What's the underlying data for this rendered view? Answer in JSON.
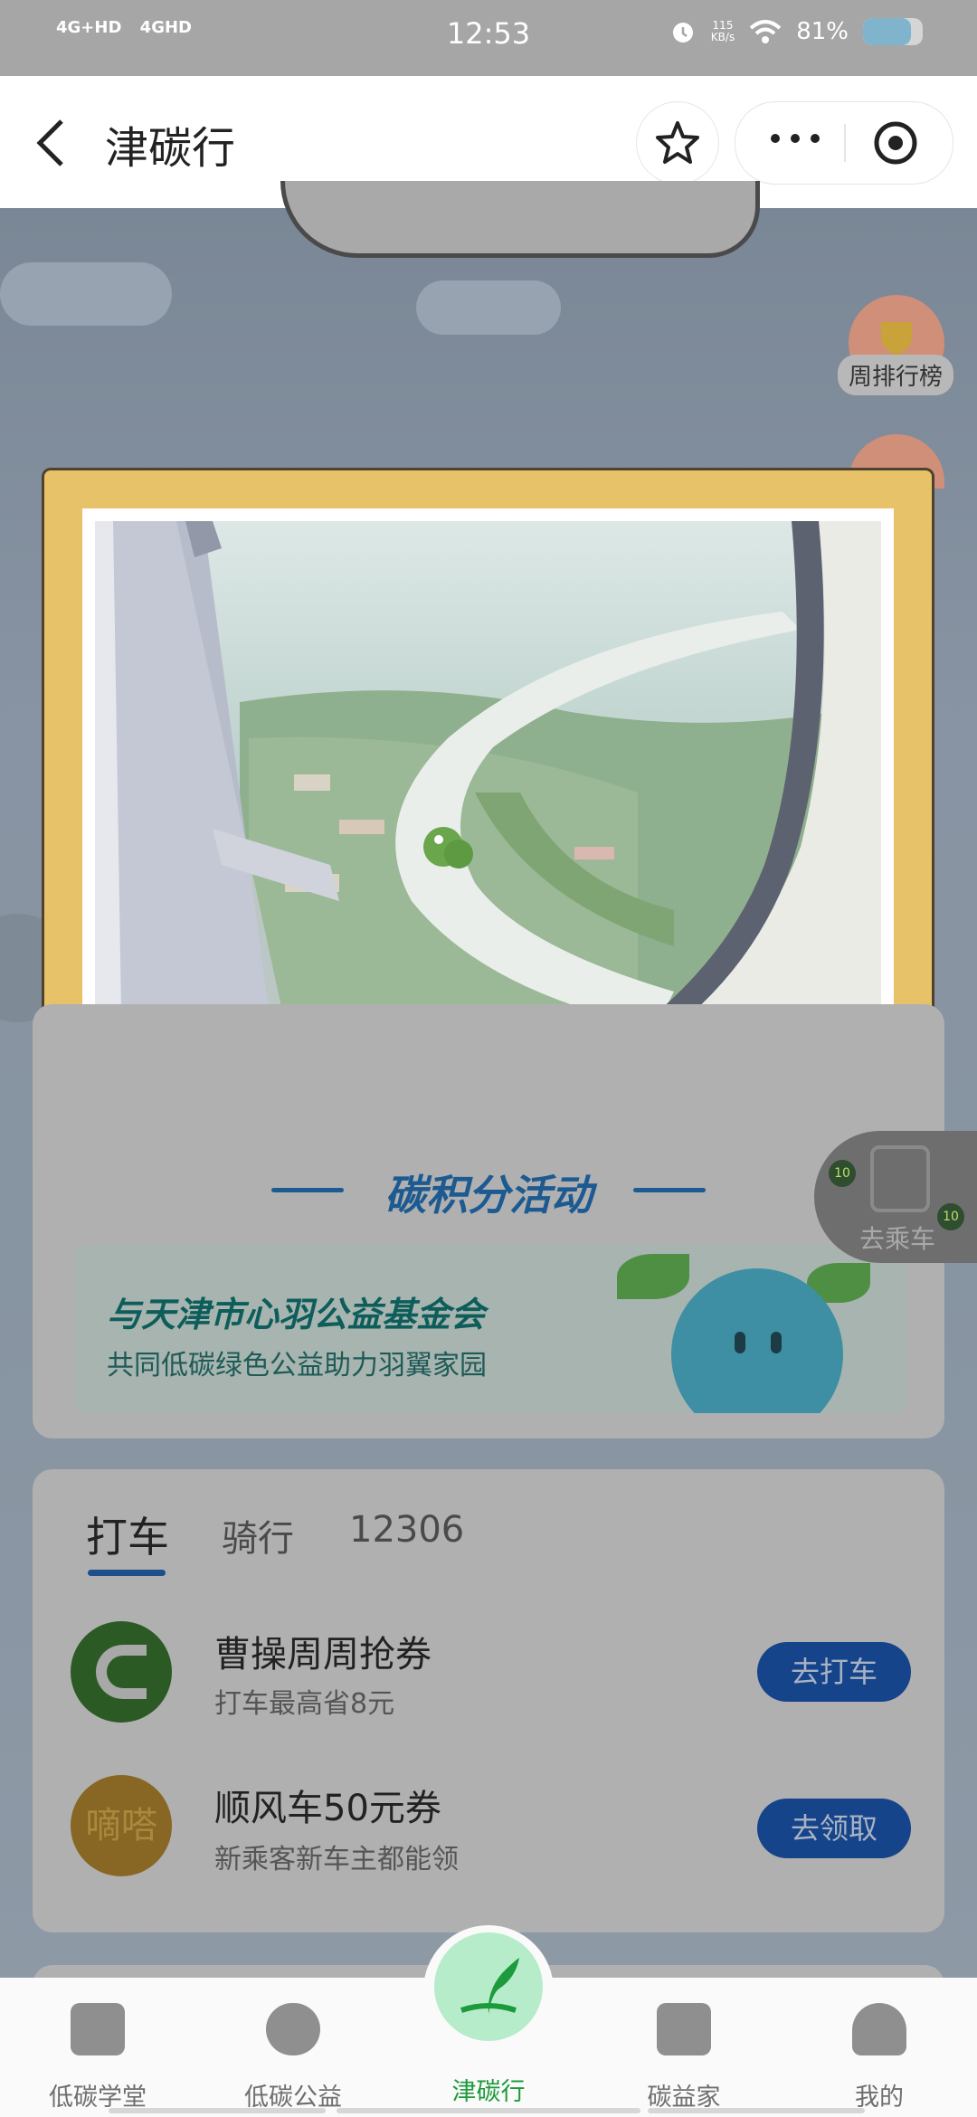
{
  "status_bar": {
    "signal1": "4G+HD",
    "signal2": "4GHD",
    "time": "12:53",
    "speed_value": "115",
    "speed_unit": "KB/s",
    "battery_text": "81%",
    "battery_level": 0.81
  },
  "navbar": {
    "title": "津碳行",
    "back_icon": "chevron-left-icon",
    "star_icon": "star-icon",
    "more_icon": "more-dots-icon",
    "target_icon": "target-icon"
  },
  "side": {
    "weekly_rank_label": "周排行榜"
  },
  "activity": {
    "title": "碳积分活动",
    "banner_line1": "与天津市心羽公益基金会",
    "banner_line2": "共同低碳绿色公益助力羽翼家园"
  },
  "ride_button": {
    "label": "去乘车",
    "badge": "10"
  },
  "tabs": [
    {
      "label": "打车",
      "active": true
    },
    {
      "label": "骑行",
      "active": false
    },
    {
      "label": "12306",
      "active": false
    }
  ],
  "coupons": [
    {
      "title": "曹操周周抢券",
      "subtitle": "打车最高省8元",
      "button": "去打车"
    },
    {
      "title": "顺风车50元券",
      "subtitle": "新乘客新车主都能领",
      "button": "去领取",
      "logo_text": "嘀嗒"
    }
  ],
  "tabbar": [
    {
      "label": "低碳学堂",
      "icon": "book-icon"
    },
    {
      "label": "低碳公益",
      "icon": "heart-hands-icon"
    },
    {
      "label": "津碳行",
      "icon": "sprout-icon",
      "active": true
    },
    {
      "label": "碳益家",
      "icon": "shop-icon"
    },
    {
      "label": "我的",
      "icon": "person-icon"
    }
  ],
  "colors": {
    "modal_frame": "#e7c268",
    "active_tab": "#1d9a3c",
    "button_blue": "#16448a"
  }
}
